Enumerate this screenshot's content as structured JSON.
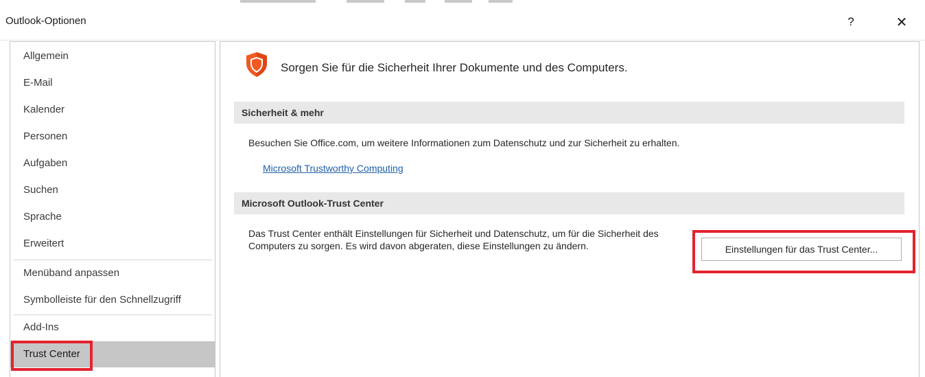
{
  "window": {
    "title": "Outlook-Optionen",
    "help_label": "?",
    "close_label": "✕"
  },
  "sidebar": {
    "items": [
      {
        "label": "Allgemein"
      },
      {
        "label": "E-Mail"
      },
      {
        "label": "Kalender"
      },
      {
        "label": "Personen"
      },
      {
        "label": "Aufgaben"
      },
      {
        "label": "Suchen"
      },
      {
        "label": "Sprache"
      },
      {
        "label": "Erweitert"
      },
      {
        "label": "Menüband anpassen"
      },
      {
        "label": "Symbolleiste für den Schnellzugriff"
      },
      {
        "label": "Add-Ins"
      },
      {
        "label": "Trust Center",
        "selected": true
      }
    ]
  },
  "main": {
    "headline": "Sorgen Sie für die Sicherheit Ihrer Dokumente und des Computers.",
    "security_section": {
      "heading": "Sicherheit & mehr",
      "text": "Besuchen Sie Office.com, um weitere Informationen zum Datenschutz und zur Sicherheit zu erhalten.",
      "link": "Microsoft Trustworthy Computing"
    },
    "trust_section": {
      "heading": "Microsoft Outlook-Trust Center",
      "text": "Das Trust Center enthält Einstellungen für Sicherheit und Datenschutz, um für die Sicherheit des Computers zu sorgen. Es wird davon abgeraten, diese Einstellungen zu ändern.",
      "button": "Einstellungen für das Trust Center..."
    }
  },
  "colors": {
    "highlight": "#e3232e",
    "shield": "#f05a22",
    "link": "#1f5fa8",
    "selected_bg": "#c6c6c6"
  },
  "icons": {
    "shield": "shield-icon"
  }
}
